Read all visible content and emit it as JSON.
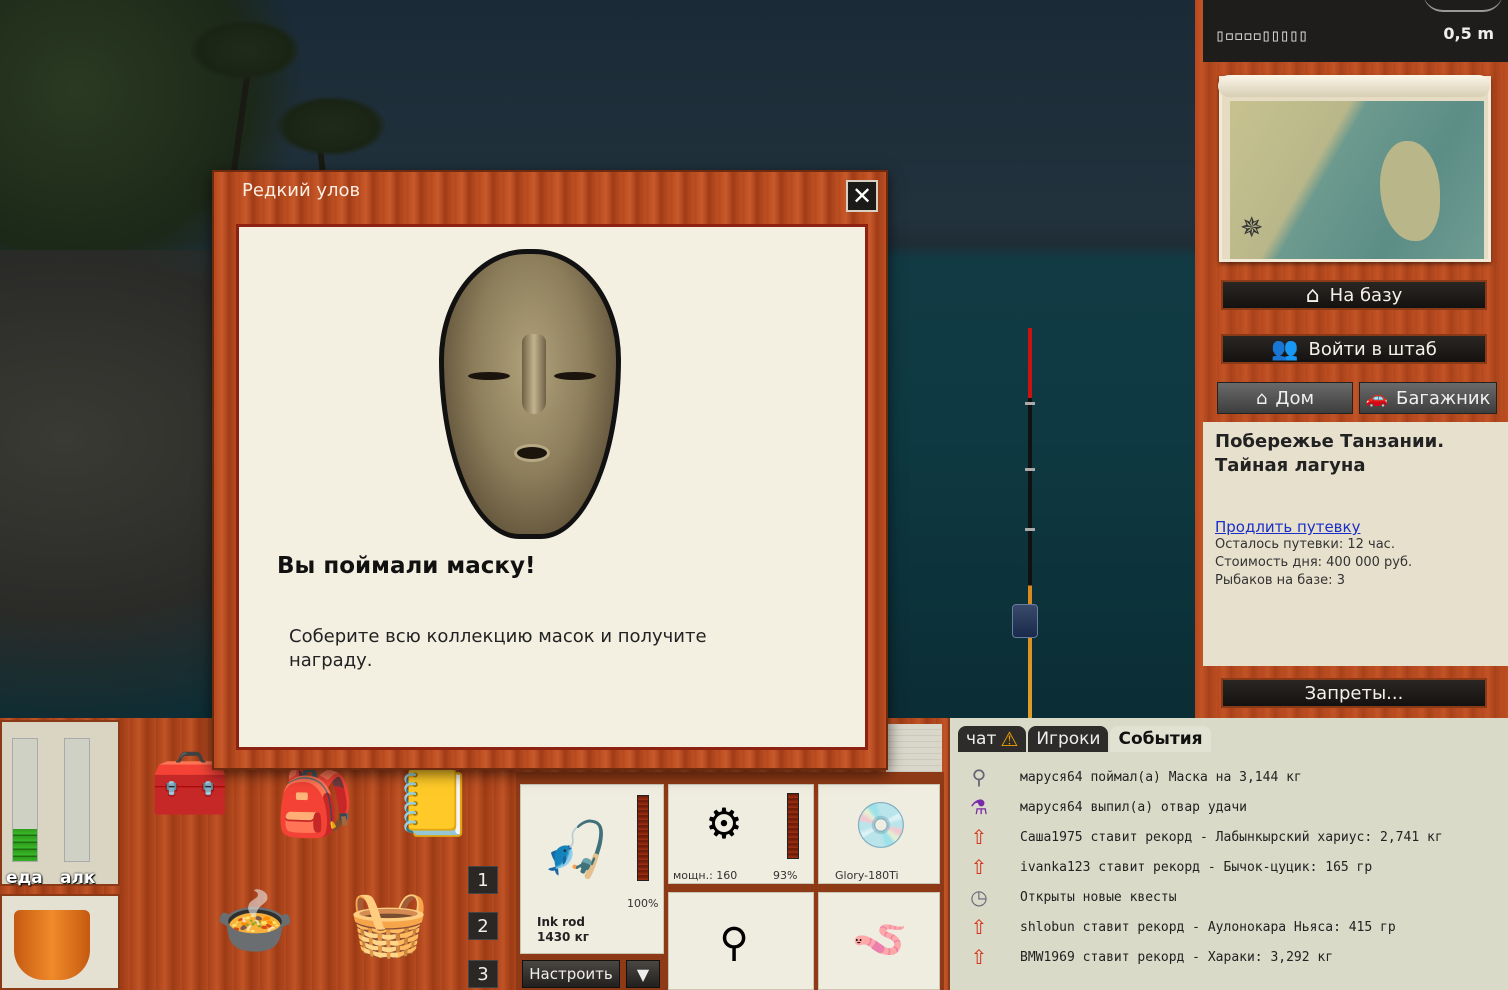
{
  "depth": {
    "scale": "▯▫▫▫▫▯▯▯▯▯",
    "value": "0,5 m"
  },
  "nav": {
    "to_base": "На базу",
    "headquarters": "Войти в штаб",
    "home": "Дом",
    "trunk": "Багажник",
    "bans": "Запреты..."
  },
  "location": {
    "title_line1": "Побережье Танзании.",
    "title_line2": "Тайная лагуна",
    "extend_link": "Продлить путевку",
    "time_left": "Осталось путевки: 12 час.",
    "day_cost": "Стоимость дня: 400 000 руб.",
    "fishers": "Рыбаков на базе: 3"
  },
  "meters": {
    "food_label": "еда",
    "alc_label": "алк",
    "food_level": 0.26,
    "alc_level": 0
  },
  "slots": [
    "1",
    "2",
    "3"
  ],
  "tackle": {
    "rod_name": "Ink rod",
    "rod_weight": "1430 кг",
    "rod_percent": "100%",
    "reel_power": "мощн.: 160",
    "reel_percent": "93%",
    "line_name": "Glory-180Ti",
    "tune_button": "Настроить",
    "dropdown_glyph": "▼"
  },
  "chat": {
    "tabs": [
      "чат",
      "Игроки",
      "События"
    ],
    "active_tab": 2,
    "events": [
      {
        "icon": "rattle-icon",
        "glyph": "⚲",
        "text": "маруся64 поймал(а) Маска на 3,144 кг"
      },
      {
        "icon": "potion-icon",
        "glyph": "⚗",
        "text": "маруся64 выпил(а) отвар удачи"
      },
      {
        "icon": "record-arrow-icon",
        "glyph": "⇧",
        "text": "Саша1975 ставит рекорд - Лабынкырский хариус: 2,741 кг"
      },
      {
        "icon": "record-arrow-icon",
        "glyph": "⇧",
        "text": "ivanka123 ставит рекорд - Бычок-цуцик: 165 гр"
      },
      {
        "icon": "clock-icon",
        "glyph": "◷",
        "text": "Открыты новые квесты"
      },
      {
        "icon": "record-arrow-icon",
        "glyph": "⇧",
        "text": "shlobun ставит рекорд - Аулонокара Ньяса: 415 гр"
      },
      {
        "icon": "record-arrow-icon",
        "glyph": "⇧",
        "text": "BMW1969 ставит рекорд - Хараки: 3,292 кг"
      }
    ]
  },
  "modal": {
    "title": "Редкий улов",
    "close_glyph": "✕",
    "heading": "Вы поймали маску!",
    "text": "Соберите всю коллекцию масок и получите награду."
  },
  "colors": {
    "wood": "#b5481d",
    "panel_bg": "#e6e0cc",
    "link": "#1a2ec8",
    "meter_green": "#39b72a"
  }
}
